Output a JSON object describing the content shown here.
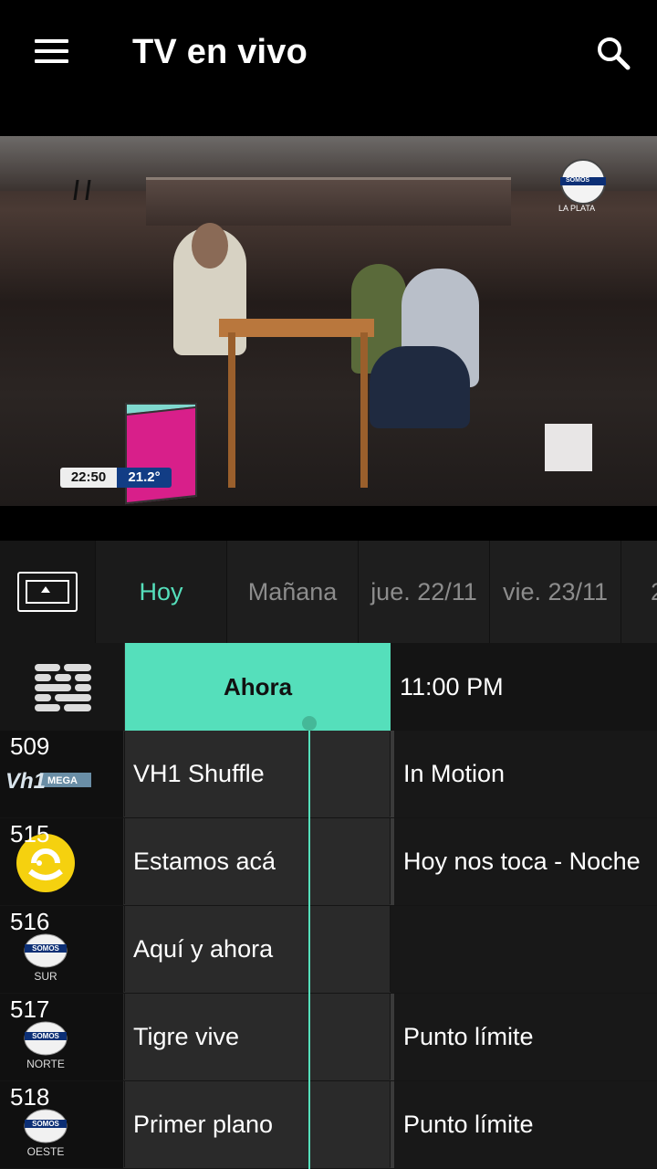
{
  "header": {
    "title": "TV en vivo"
  },
  "video": {
    "overlay_time": "22:50",
    "overlay_temp": "21.2°",
    "channel_logo_text": "SOMOS",
    "channel_logo_sub": "LA PLATA"
  },
  "days": [
    {
      "label": "Hoy",
      "active": true
    },
    {
      "label": "Mañana",
      "active": false
    },
    {
      "label": "jue. 22/11",
      "active": false
    },
    {
      "label": "vie. 23/11",
      "active": false
    },
    {
      "label": "2",
      "active": false
    }
  ],
  "guide": {
    "now_label": "Ahora",
    "next_time": "11:00 PM",
    "channels": [
      {
        "number": "509",
        "logo": "VH1 MEGA HITS",
        "now": "VH1 Shuffle",
        "next": "In Motion"
      },
      {
        "number": "515",
        "logo": "yellow-circle-logo",
        "now": "Estamos acá",
        "next": "Hoy nos toca - Noche"
      },
      {
        "number": "516",
        "logo": "SOMOS",
        "logo_sub": "SUR",
        "now": "Aquí y ahora",
        "next": ""
      },
      {
        "number": "517",
        "logo": "SOMOS",
        "logo_sub": "NORTE",
        "now": "Tigre vive",
        "next": "Punto límite"
      },
      {
        "number": "518",
        "logo": "SOMOS",
        "logo_sub": "OESTE",
        "now": "Primer plano",
        "next": "Punto límite"
      }
    ]
  },
  "colors": {
    "accent": "#55dfbb",
    "background": "#000000",
    "surface": "#1e1e1e"
  }
}
